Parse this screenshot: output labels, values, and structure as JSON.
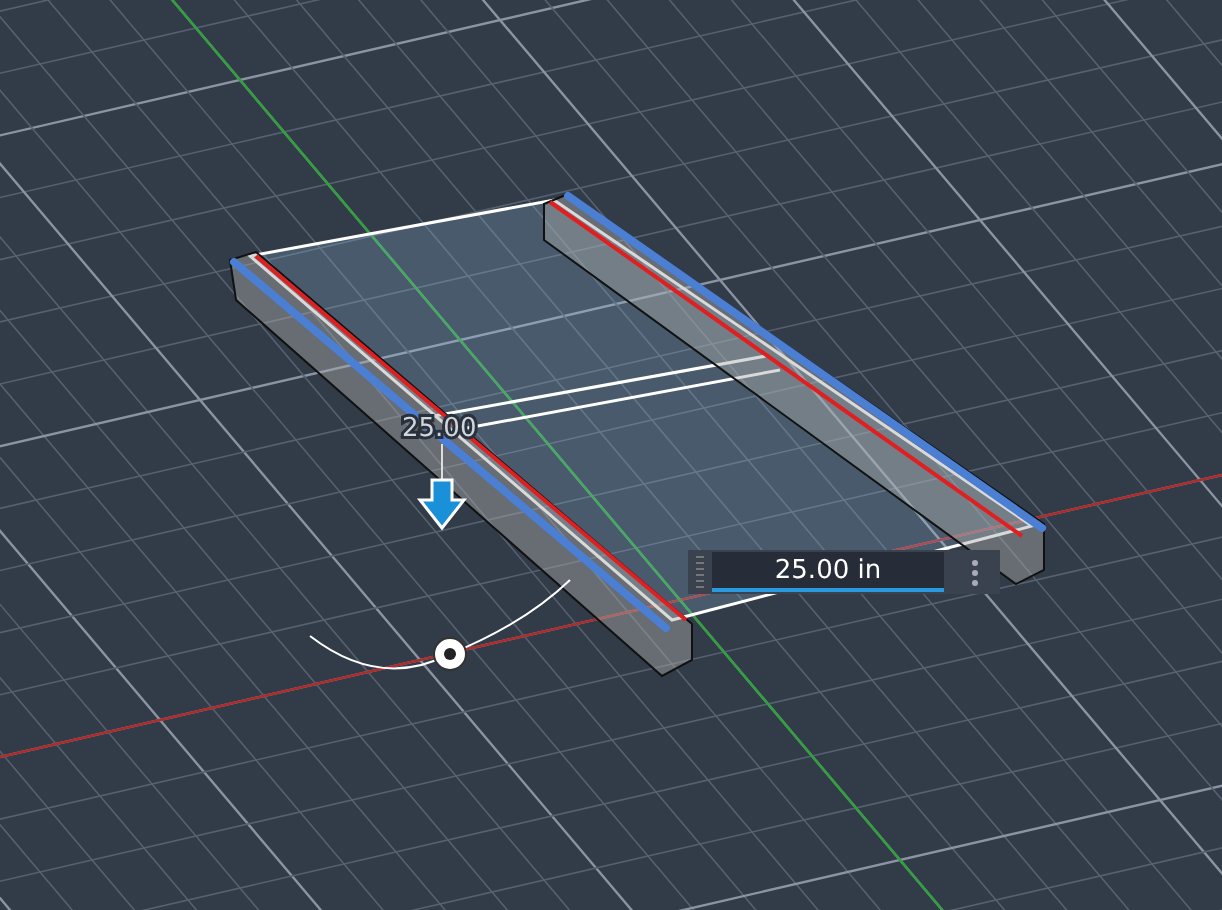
{
  "dimension_label": "25.00",
  "length_input": {
    "value": "25.00 in"
  }
}
